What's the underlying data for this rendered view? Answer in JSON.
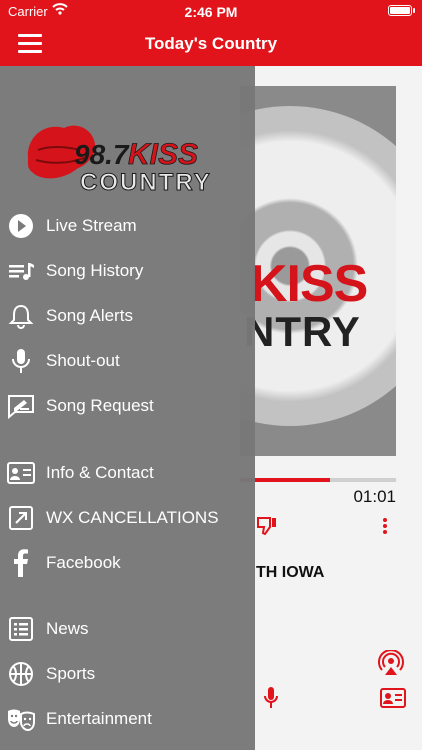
{
  "status_bar": {
    "carrier": "Carrier",
    "time": "2:46 PM"
  },
  "header": {
    "title": "Today's Country",
    "accent_color": "#e1141b"
  },
  "logo": {
    "number": "98.7",
    "word": "KISS",
    "sub": "COUNTRY"
  },
  "drawer": {
    "items": [
      {
        "label": "Live Stream",
        "icon": "play-circle-icon"
      },
      {
        "label": "Song History",
        "icon": "playlist-icon"
      },
      {
        "label": "Song Alerts",
        "icon": "bell-icon"
      },
      {
        "label": "Shout-out",
        "icon": "microphone-icon"
      },
      {
        "label": "Song Request",
        "icon": "request-form-icon"
      },
      {
        "label": "Info & Contact",
        "icon": "contact-card-icon"
      },
      {
        "label": "WX CANCELLATIONS",
        "icon": "external-link-icon"
      },
      {
        "label": "Facebook",
        "icon": "facebook-icon"
      },
      {
        "label": "News",
        "icon": "news-list-icon"
      },
      {
        "label": "Sports",
        "icon": "basketball-icon"
      },
      {
        "label": "Entertainment",
        "icon": "theater-masks-icon"
      }
    ]
  },
  "player": {
    "art_kiss": "KISS",
    "art_country": "NTRY",
    "elapsed": "01:01",
    "progress": 0.58,
    "station_text": "TH IOWA"
  }
}
